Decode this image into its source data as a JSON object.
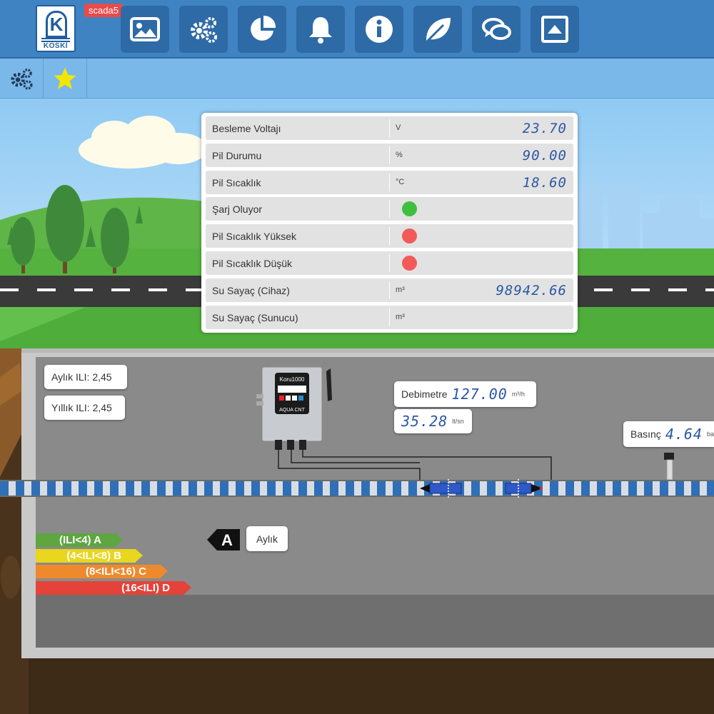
{
  "app": {
    "logo_text": "KOSKİ",
    "badge": "scada5"
  },
  "nav": {
    "items": [
      {
        "name": "image-icon"
      },
      {
        "name": "gears-icon"
      },
      {
        "name": "pie-chart-icon"
      },
      {
        "name": "bell-icon"
      },
      {
        "name": "info-icon"
      },
      {
        "name": "leaf-icon"
      },
      {
        "name": "chat-icon"
      },
      {
        "name": "upload-icon"
      }
    ]
  },
  "subbar": {
    "items": [
      {
        "name": "gears-icon"
      },
      {
        "name": "star-icon",
        "color": "#f2e600"
      }
    ]
  },
  "panel": {
    "rows": [
      {
        "label": "Besleme Voltajı",
        "unit": "V",
        "value": "23.70"
      },
      {
        "label": "Pil Durumu",
        "unit": "%",
        "value": "90.00"
      },
      {
        "label": "Pil Sıcaklık",
        "unit": "°C",
        "value": "18.60"
      },
      {
        "label": "Şarj Oluyor",
        "unit": "",
        "value": "",
        "status_color": "#3fbf3f"
      },
      {
        "label": "Pil Sıcaklık Yüksek",
        "unit": "",
        "value": "",
        "status_color": "#f25a5a"
      },
      {
        "label": "Pil Sıcaklık Düşük",
        "unit": "",
        "value": "",
        "status_color": "#f25a5a"
      },
      {
        "label": "Su Sayaç (Cihaz)",
        "unit": "m³",
        "value": "98942.66"
      },
      {
        "label": "Su Sayaç (Sunucu)",
        "unit": "m³",
        "value": ""
      }
    ]
  },
  "ili": {
    "monthly": "Aylık ILI: 2,45",
    "yearly": "Yıllık ILI: 2,45"
  },
  "device": {
    "model": "Koru1000",
    "brand": "AQUA CNT"
  },
  "flow": {
    "label": "Debimetre",
    "value": "127.00",
    "unit": "m³/h",
    "value2": "35.28",
    "unit2": "lt/sn"
  },
  "pressure": {
    "label": "Basınç",
    "value": "4.64",
    "unit": "bar"
  },
  "rating": {
    "current_grade": "A",
    "period": "Aylık",
    "bands": [
      {
        "text": "(ILI<4) A",
        "color": "#5ea640"
      },
      {
        "text": "(4<ILI<8) B",
        "color": "#e8d61f"
      },
      {
        "text": "(8<ILI<16) C",
        "color": "#ee8a2c"
      },
      {
        "text": "(16<ILI) D",
        "color": "#e4433a"
      }
    ]
  }
}
